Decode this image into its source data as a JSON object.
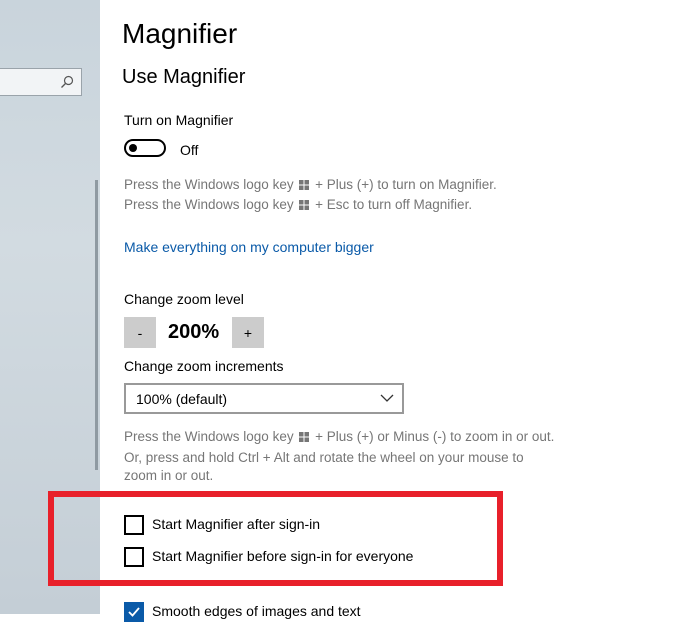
{
  "sidebar": {
    "search": {
      "placeholder": "",
      "icon": "search-icon"
    }
  },
  "main": {
    "page_title": "Magnifier",
    "section_title": "Use Magnifier",
    "turn_on": {
      "label": "Turn on Magnifier",
      "state_label": "Off",
      "is_on": false
    },
    "shortcut_hint": {
      "line1_a": "Press the Windows logo key",
      "line1_b": "+ Plus (+) to turn on Magnifier.",
      "line2_a": "Press the Windows logo key",
      "line2_b": "+ Esc to turn off Magnifier."
    },
    "link_bigger": "Make everything on my computer bigger",
    "zoom": {
      "label": "Change zoom level",
      "minus": "-",
      "value": "200%",
      "plus": "+"
    },
    "increments": {
      "label": "Change zoom increments",
      "selected": "100% (default)"
    },
    "zoom_hint": {
      "line1_a": "Press the Windows logo key",
      "line1_b": "+ Plus (+) or Minus (-) to zoom in or out.",
      "line2": "Or, press and hold Ctrl + Alt and rotate the wheel on your mouse to",
      "line3": "zoom in or out."
    },
    "checkboxes": [
      {
        "label": "Start Magnifier after sign-in",
        "checked": false
      },
      {
        "label": "Start Magnifier before sign-in for everyone",
        "checked": false
      },
      {
        "label": "Smooth edges of images and text",
        "checked": true
      }
    ],
    "colors": {
      "accent": "#0a5aa8",
      "highlight": "#e8202a",
      "hint_text": "#767676"
    }
  }
}
